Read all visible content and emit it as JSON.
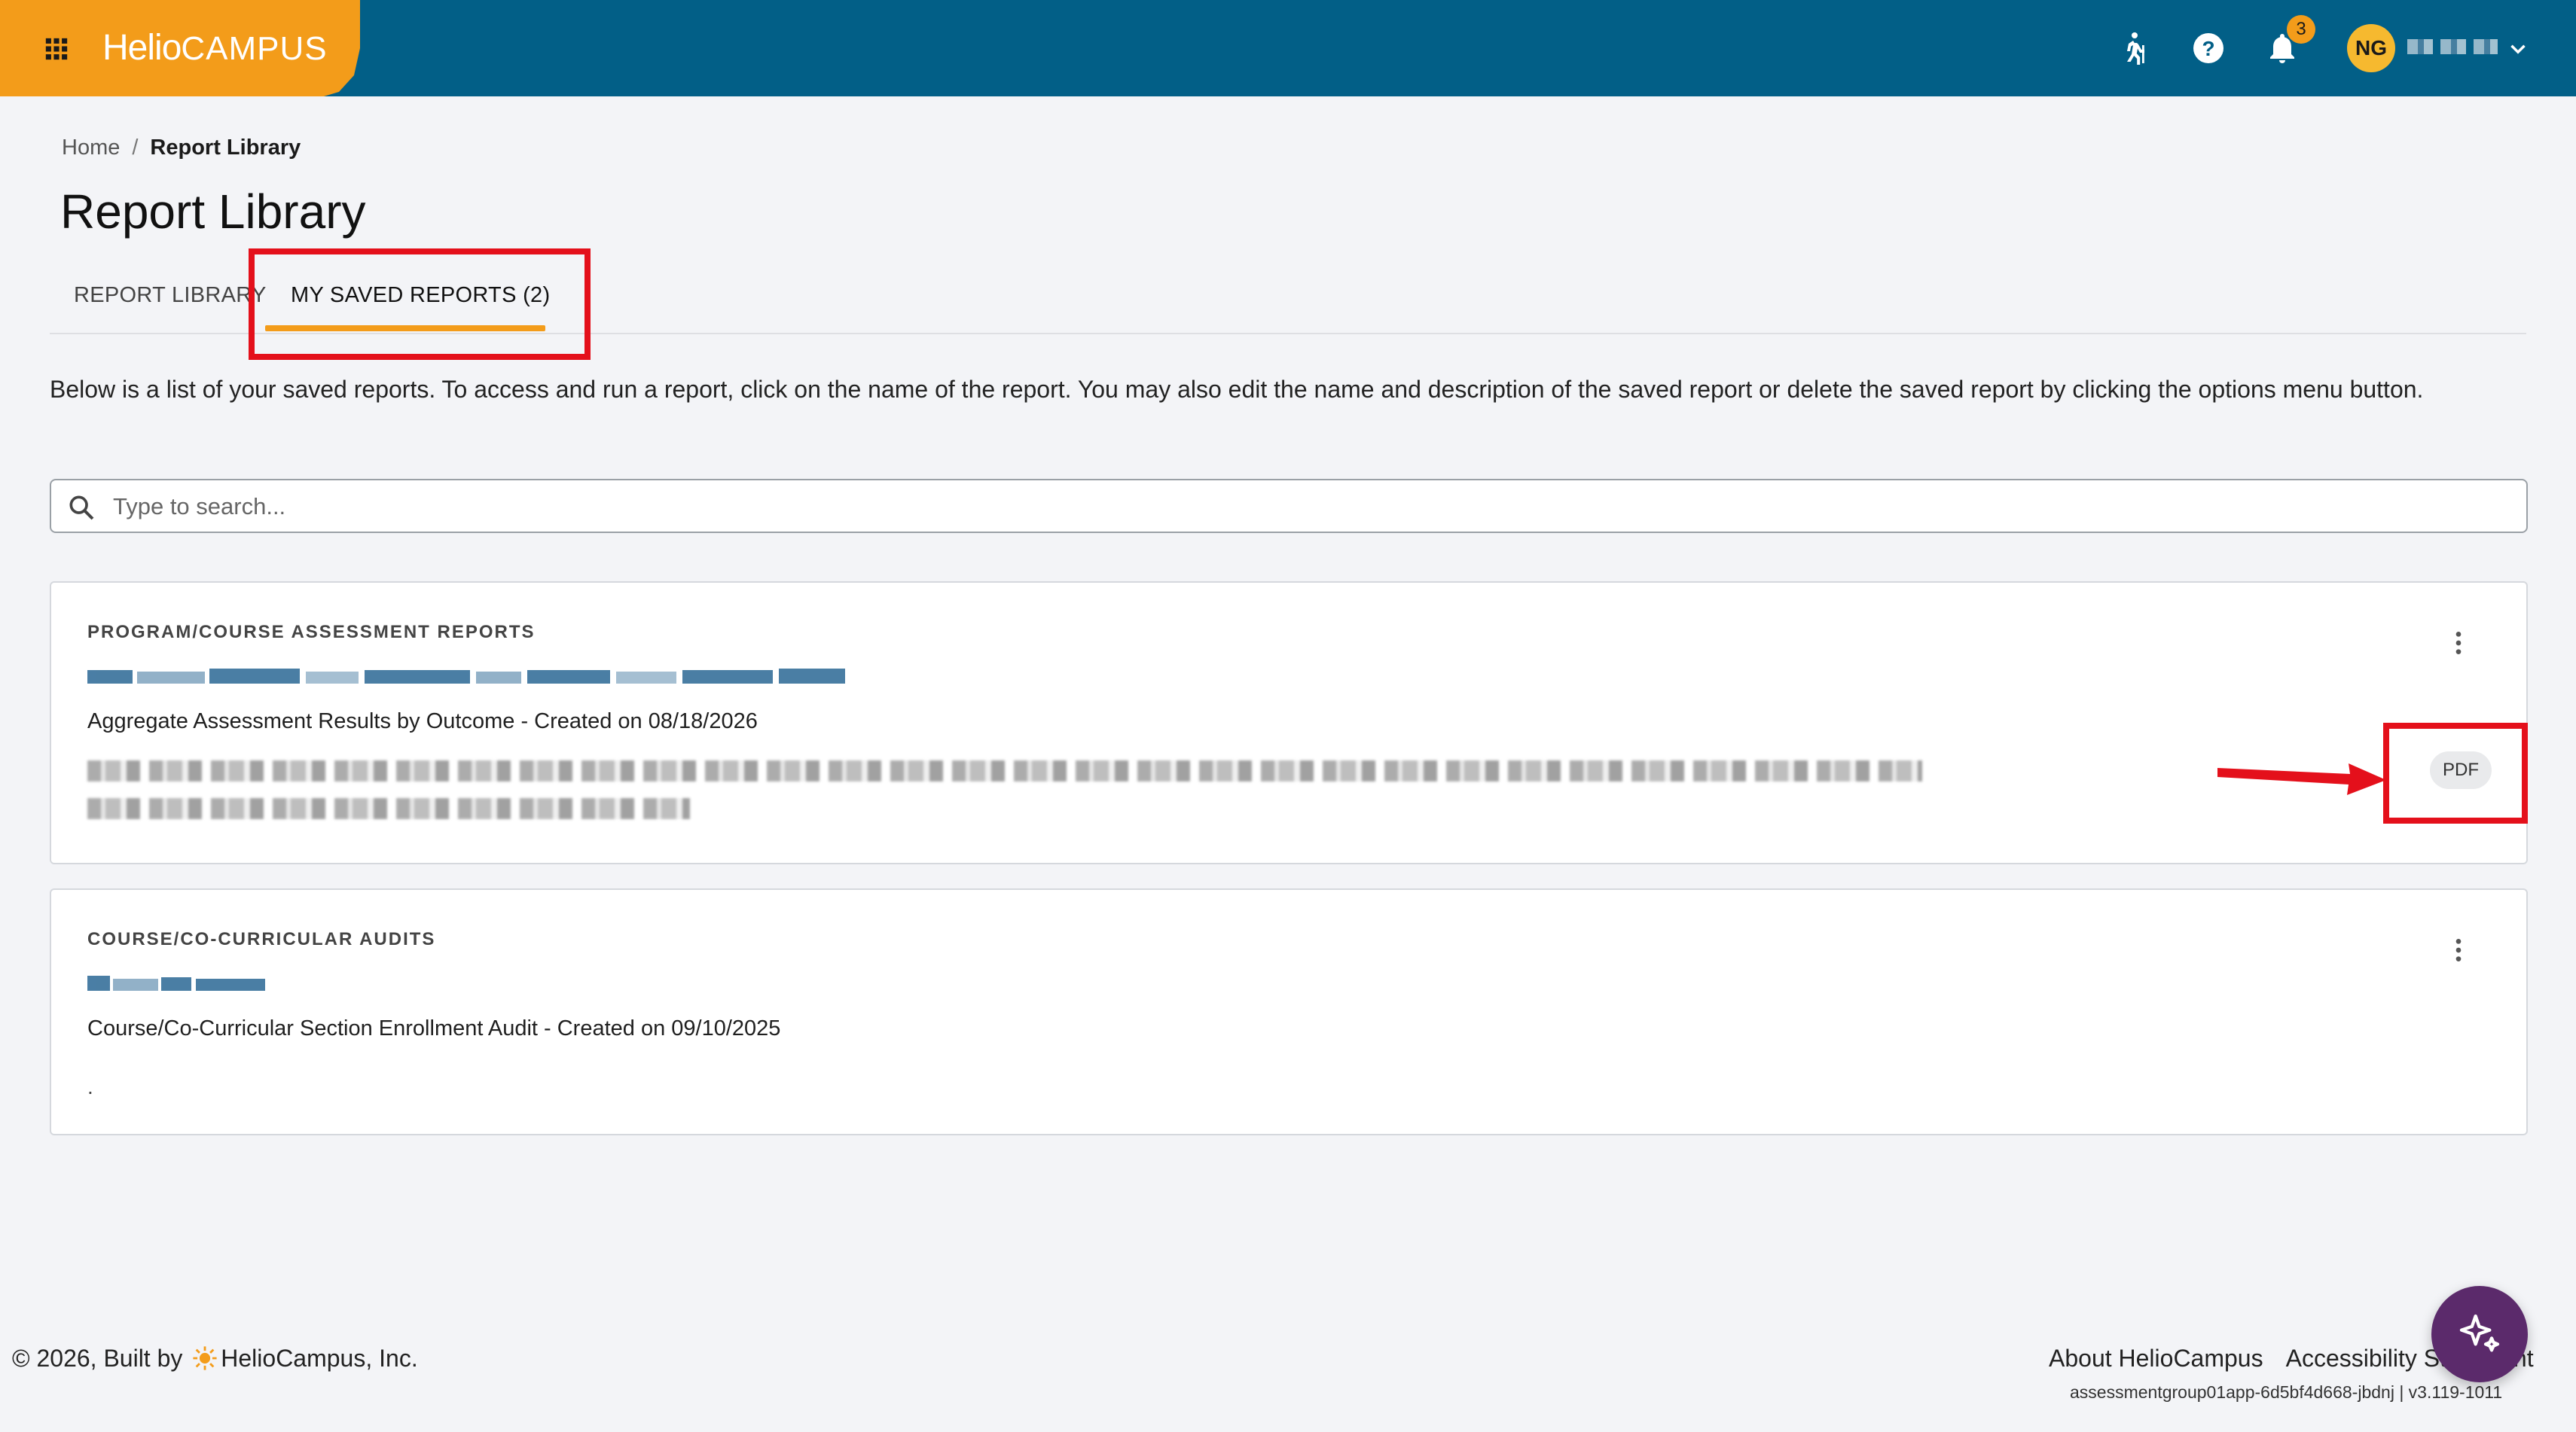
{
  "header": {
    "brand_bold": "Helio",
    "brand_light": "CAMPUS",
    "notifications_count": "3",
    "avatar_initials": "NG",
    "colors": {
      "header_bg": "#025f87",
      "brand_bg": "#f39c1a",
      "avatar_bg": "#f6b92f"
    },
    "icons": [
      "grid-icon",
      "hiking-icon",
      "help-icon",
      "bell-icon",
      "chevron-down-icon"
    ]
  },
  "breadcrumb": {
    "home": "Home",
    "separator": "/",
    "current": "Report Library"
  },
  "page_title": "Report Library",
  "tabs": [
    {
      "label": "REPORT LIBRARY",
      "active": false
    },
    {
      "label": "MY SAVED REPORTS (2)",
      "active": true
    }
  ],
  "description": "Below is a list of your saved reports. To access and run a report, click on the name of the report. You may also edit the name and description of the saved report or delete the saved report by clicking the options menu button.",
  "search": {
    "placeholder": "Type to search..."
  },
  "reports": [
    {
      "category": "PROGRAM/COURSE ASSESSMENT REPORTS",
      "subtitle": "Aggregate Assessment Results by Outcome - Created on 08/18/2026",
      "badge": "PDF"
    },
    {
      "category": "COURSE/CO-CURRICULAR AUDITS",
      "subtitle": "Course/Co-Curricular Section Enrollment Audit - Created on 09/10/2025",
      "description": "."
    }
  ],
  "footer": {
    "copyright_prefix": "© 2026, Built by",
    "company": "HelioCampus, Inc.",
    "links": [
      "About HelioCampus",
      "Accessibility Statement"
    ],
    "version": "assessmentgroup01app-6d5bf4d668-jbdnj | v3.119-1011"
  },
  "annotations": {
    "highlight_color": "#e4101b"
  }
}
